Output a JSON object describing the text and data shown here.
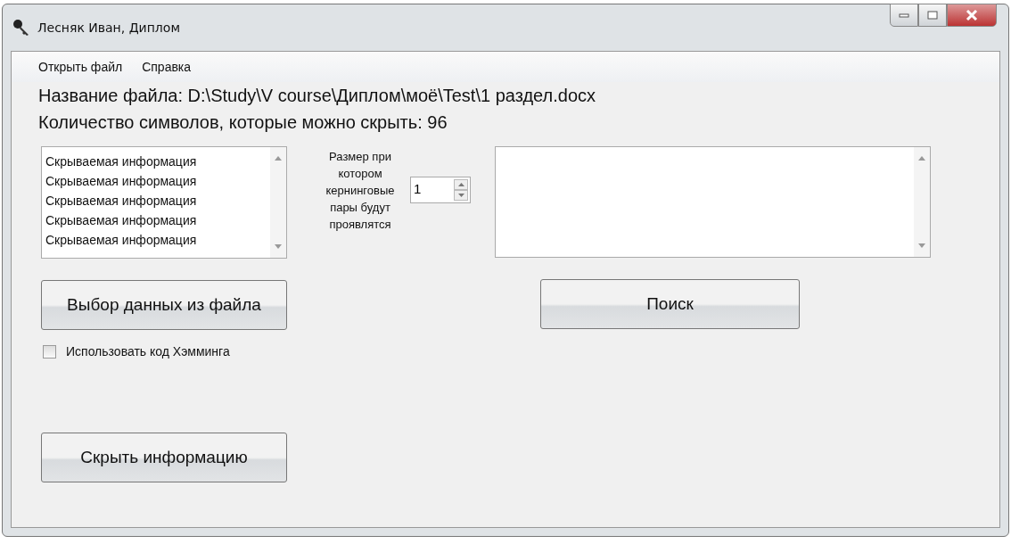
{
  "window": {
    "title": "Лесняк Иван, Диплом"
  },
  "menu": [
    "Открыть файл",
    "Справка"
  ],
  "file_label": "Название файла: D:\\Study\\V course\\Диплом\\моё\\Test\\1 раздел.docx",
  "count_label": "Количество символов, которые можно скрыть: 96",
  "hidden_info_list": {
    "items": [
      "Скрываемая информация",
      "Скрываемая информация",
      "Скрываемая информация",
      "Скрываемая информация",
      "Скрываемая информация"
    ]
  },
  "kerning_label": "Размер при котором кернинговые пары будут проявлятся",
  "kerning_size": {
    "value": "1"
  },
  "select_button": "Выбор данных из файла",
  "hamming_checkbox": {
    "label": "Использовать код Хэмминга",
    "checked": false
  },
  "hide_button": "Скрыть информацию",
  "search_button": "Поиск"
}
